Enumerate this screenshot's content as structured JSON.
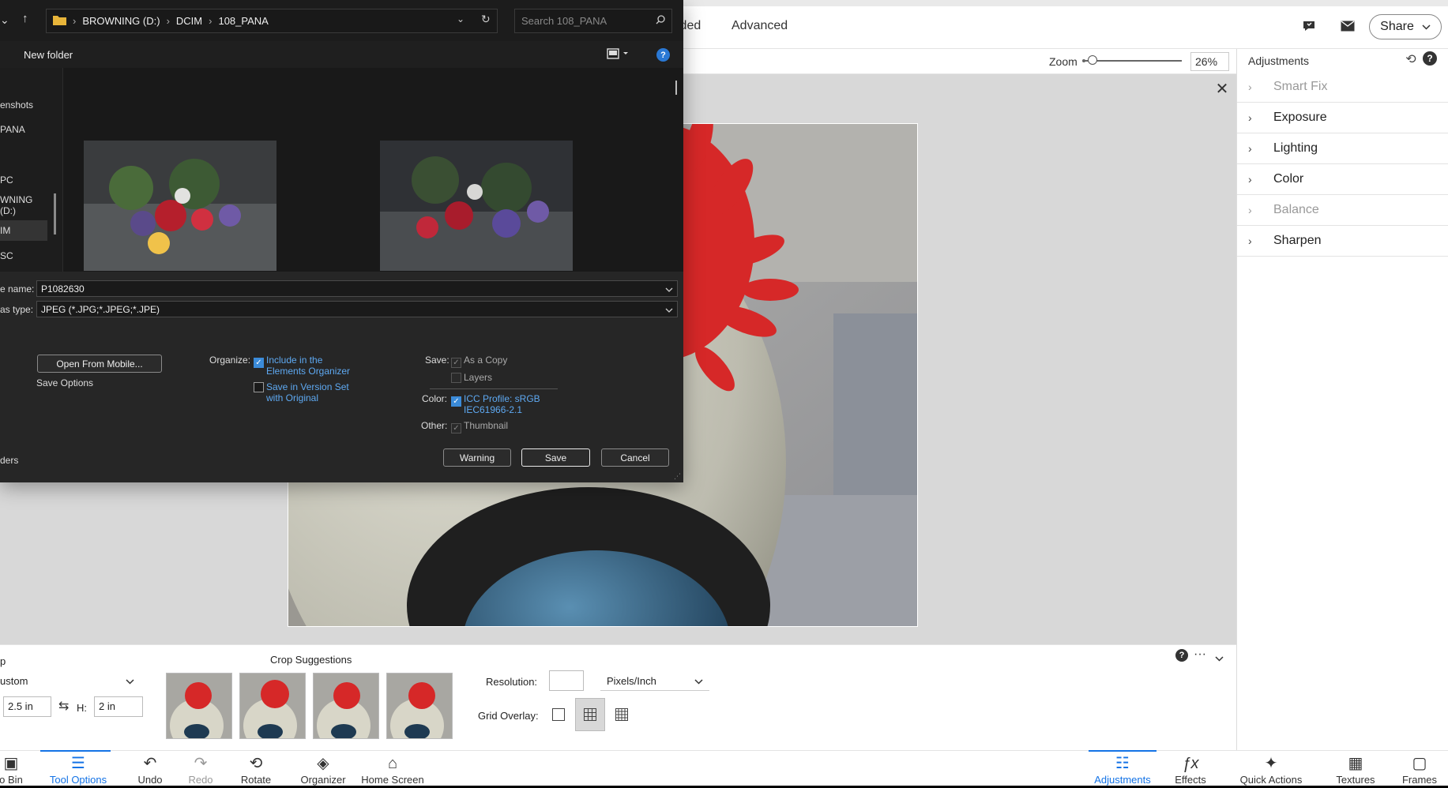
{
  "app": {
    "mode_tabs": [
      "ided",
      "Advanced"
    ],
    "share_label": "Share",
    "zoom_label": "Zoom",
    "zoom_value": "26%"
  },
  "adjustments": {
    "title": "Adjustments",
    "items": [
      {
        "label": "Smart Fix",
        "enabled": false
      },
      {
        "label": "Exposure",
        "enabled": true
      },
      {
        "label": "Lighting",
        "enabled": true
      },
      {
        "label": "Color",
        "enabled": true
      },
      {
        "label": "Balance",
        "enabled": false
      },
      {
        "label": "Sharpen",
        "enabled": true
      }
    ]
  },
  "tool_options": {
    "tool_name": "p",
    "preset": "ustom",
    "width_value": "2.5 in",
    "height_label": "H:",
    "height_value": "2 in",
    "crop_suggestions_label": "Crop Suggestions",
    "resolution_label": "Resolution:",
    "resolution_value": "",
    "resolution_unit": "Pixels/Inch",
    "grid_overlay_label": "Grid Overlay:"
  },
  "taskbar": {
    "left": [
      {
        "label": "o Bin",
        "icon": "photo-bin-icon",
        "glyph": "▣"
      },
      {
        "label": "Tool Options",
        "icon": "tool-options-icon",
        "glyph": "☰",
        "active": true
      },
      {
        "label": "Undo",
        "icon": "undo-icon",
        "glyph": "↶"
      },
      {
        "label": "Redo",
        "icon": "redo-icon",
        "glyph": "↷"
      },
      {
        "label": "Rotate",
        "icon": "rotate-icon",
        "glyph": "⟲"
      },
      {
        "label": "Organizer",
        "icon": "organizer-icon",
        "glyph": "◈"
      },
      {
        "label": "Home Screen",
        "icon": "home-icon",
        "glyph": "⌂"
      }
    ],
    "right": [
      {
        "label": "Adjustments",
        "icon": "adjustments-icon",
        "glyph": "☷",
        "active": true
      },
      {
        "label": "Effects",
        "icon": "effects-icon",
        "glyph": "ƒx"
      },
      {
        "label": "Quick Actions",
        "icon": "quick-actions-icon",
        "glyph": "✦"
      },
      {
        "label": "Textures",
        "icon": "textures-icon",
        "glyph": "▦"
      },
      {
        "label": "Frames",
        "icon": "frames-icon",
        "glyph": "▢"
      }
    ]
  },
  "dialog": {
    "breadcrumb": [
      "BROWNING (D:)",
      "DCIM",
      "108_PANA"
    ],
    "search_placeholder": "Search 108_PANA",
    "new_folder_label": "New folder",
    "nav_items": [
      "enshots",
      "PANA",
      "PC",
      "WNING (D:)",
      "IM",
      "SC"
    ],
    "file_name_label": "e name:",
    "file_name_value": "P1082630",
    "save_type_label": "as type:",
    "save_type_value": "JPEG (*.JPG;*.JPEG;*.JPE)",
    "open_from_mobile_label": "Open From Mobile...",
    "save_options_label": "Save Options",
    "organize_label": "Organize:",
    "include_organizer_label": "Include in the Elements Organizer",
    "include_line1": "Include in the",
    "include_line2": "Elements Organizer",
    "version_set_line1": "Save in Version Set",
    "version_set_line2": "with Original",
    "save_label": "Save:",
    "as_copy_label": "As a Copy",
    "layers_label": "Layers",
    "color_label": "Color:",
    "icc_line1": "ICC Profile:  sRGB",
    "icc_line2": "IEC61966-2.1",
    "other_label": "Other:",
    "thumbnail_label": "Thumbnail",
    "warning_button": "Warning",
    "save_button": "Save",
    "cancel_button": "Cancel",
    "folders_label": "ders"
  },
  "colors": {
    "accent": "#1473e6",
    "dialog_bg": "#202020",
    "link": "#5ea9f2"
  }
}
